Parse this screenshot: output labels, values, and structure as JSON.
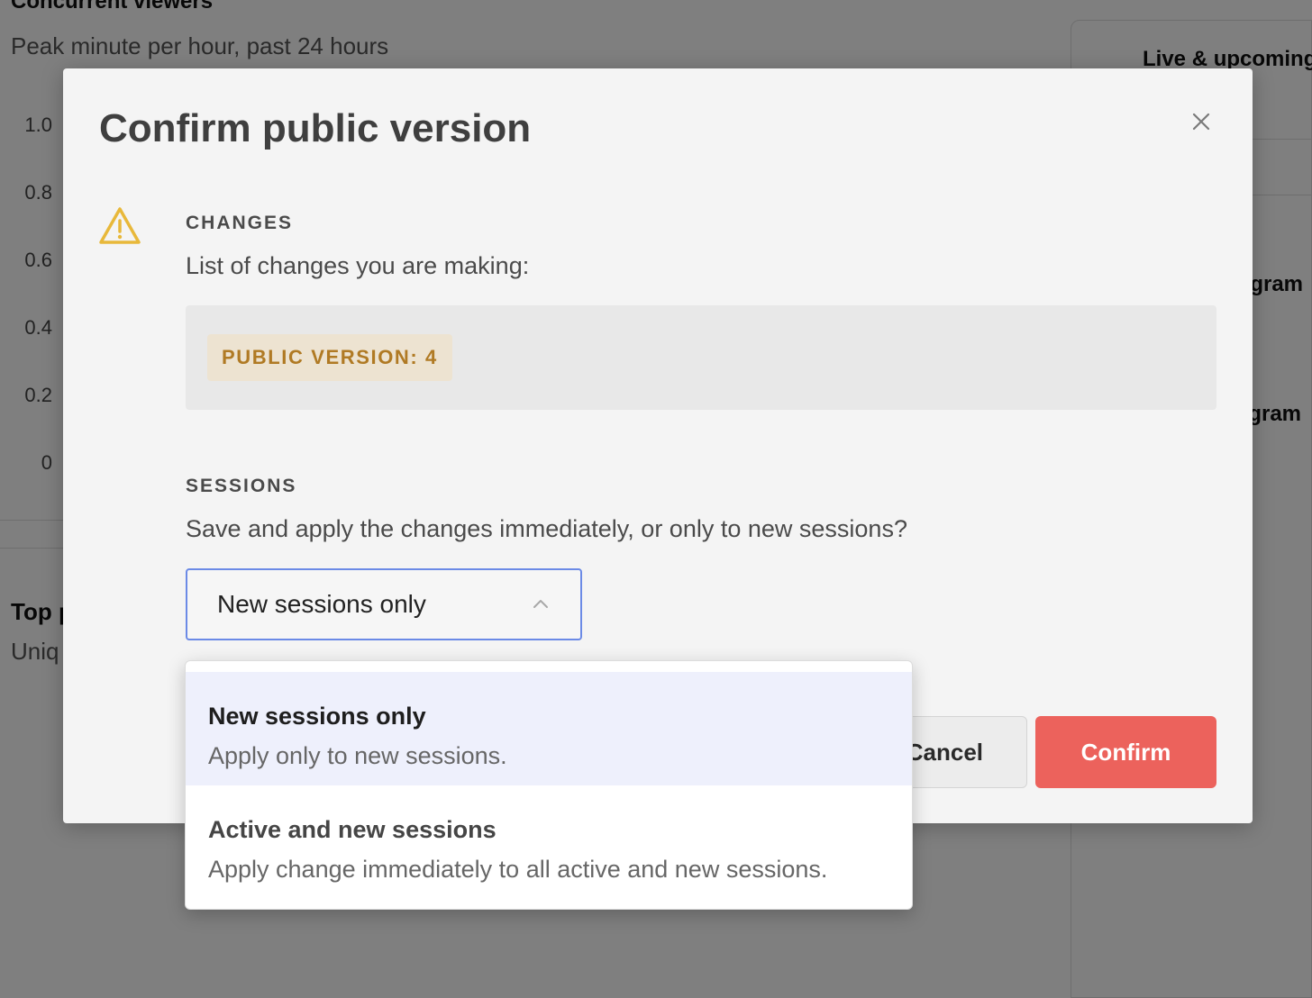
{
  "background": {
    "chart_title": "Concurrent viewers",
    "chart_subtitle": "Peak minute per hour, past 24 hours",
    "y_ticks": [
      "1.0",
      "0.8",
      "0.6",
      "0.4",
      "0.2",
      "0"
    ],
    "top_section_title": "Top p",
    "top_section_subtitle": "Uniq",
    "right_panel_title": "Live & upcoming",
    "right_items": [
      "gram",
      "gram"
    ]
  },
  "modal": {
    "title": "Confirm public version",
    "changes": {
      "label": "CHANGES",
      "description": "List of changes you are making:",
      "badge": "PUBLIC VERSION: 4"
    },
    "sessions": {
      "label": "SESSIONS",
      "description": "Save and apply the changes immediately, or only to new sessions?",
      "selected_value": "New sessions only"
    },
    "buttons": {
      "cancel": "Cancel",
      "confirm": "Confirm"
    },
    "colors": {
      "confirm_bg": "#ec625c",
      "select_border": "#6b8ae6",
      "warning_icon": "#e8b83a",
      "badge_text": "#b07a24"
    }
  },
  "dropdown": {
    "options": [
      {
        "title": "New sessions only",
        "description": "Apply only to new sessions.",
        "selected": true
      },
      {
        "title": "Active and new sessions",
        "description": "Apply change immediately to all active and new sessions.",
        "selected": false
      }
    ]
  }
}
